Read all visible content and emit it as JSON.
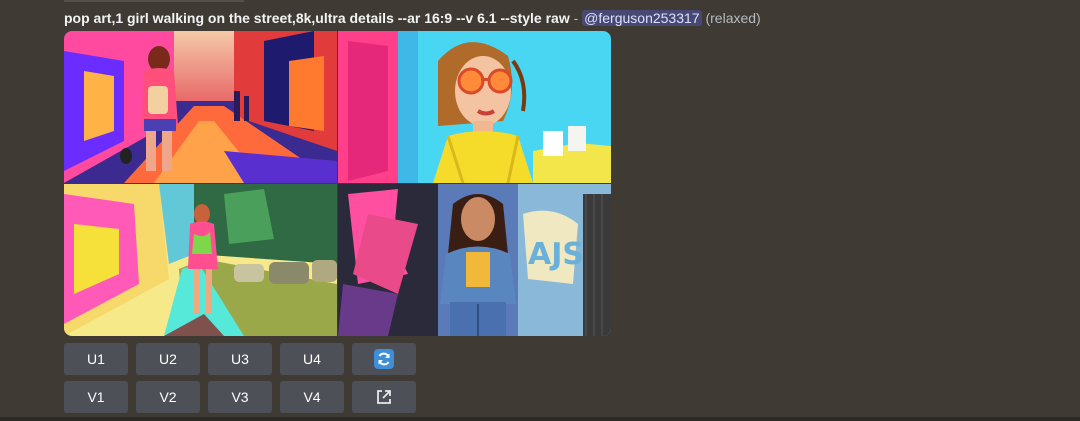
{
  "message": {
    "prompt": "pop art,1 girl walking on the street,8k,ultra details --ar 16:9 --v 6.1 --style raw",
    "separator": "-",
    "mention": "@ferguson253317",
    "mode": "(relaxed)"
  },
  "image_grid": {
    "tiles": [
      {
        "name": "girl walking away down colorful street"
      },
      {
        "name": "woman in sunglasses and yellow top"
      },
      {
        "name": "girl in pink dress walking on sunny sidewalk"
      },
      {
        "name": "woman in denim jacket before graffiti wall"
      }
    ]
  },
  "buttons": {
    "upscale": [
      "U1",
      "U2",
      "U3",
      "U4"
    ],
    "variation": [
      "V1",
      "V2",
      "V3",
      "V4"
    ],
    "reroll_icon": "refresh-icon",
    "web_icon": "external-link-icon"
  },
  "colors": {
    "background": "#3f3a34",
    "button": "#4e5058",
    "mention_bg": "#4f5289",
    "reroll_blue": "#3f8fd8"
  }
}
